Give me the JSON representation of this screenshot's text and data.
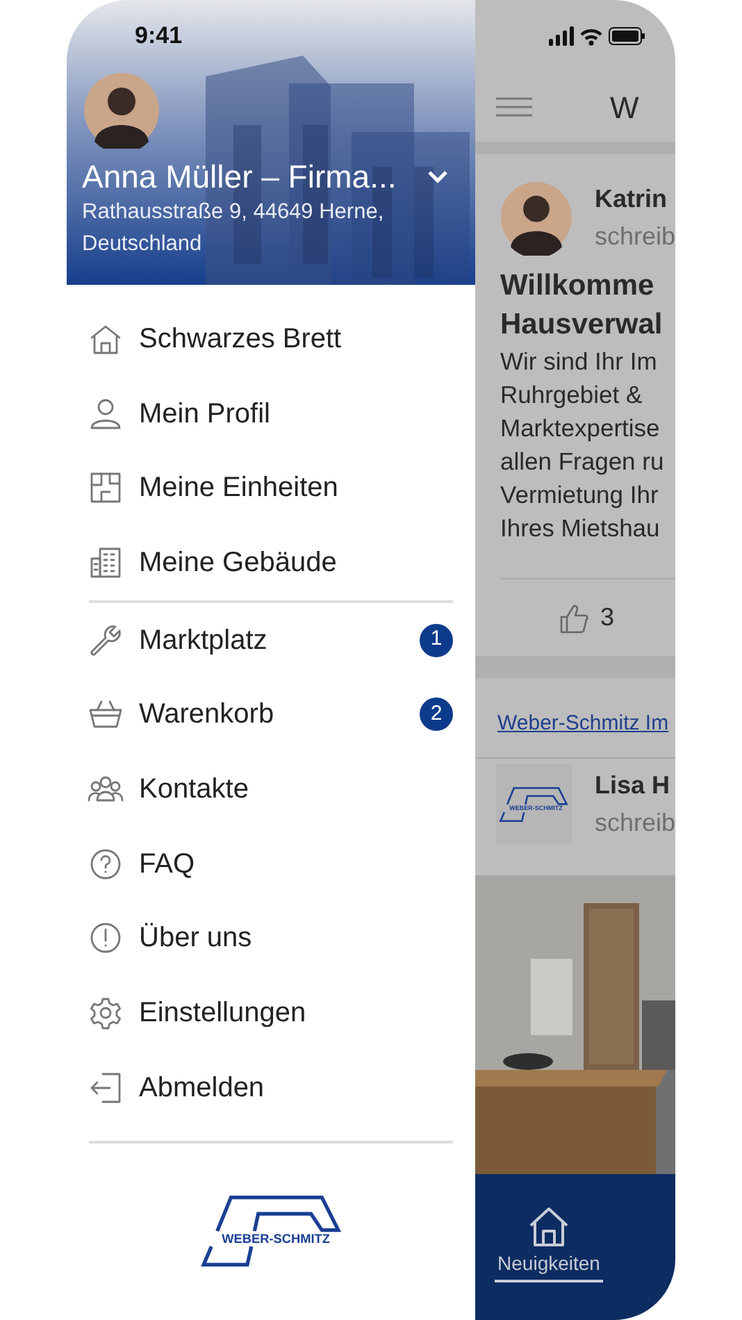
{
  "status_bar": {
    "time": "9:41"
  },
  "drawer": {
    "header": {
      "name": "Anna Müller – Firma...",
      "address": "Rathausstraße 9, 44649 Herne, Deutschland",
      "expanded": false
    },
    "menu_sections": [
      {
        "items": [
          {
            "label": "Schwarzes Brett"
          },
          {
            "label": "Mein Profil"
          },
          {
            "label": "Meine Einheiten"
          },
          {
            "label": "Meine Gebäude"
          }
        ]
      },
      {
        "items": [
          {
            "label": "Marktplatz",
            "badge": "1"
          },
          {
            "label": "Warenkorb",
            "badge": "2"
          },
          {
            "label": "Kontakte"
          },
          {
            "label": "FAQ"
          },
          {
            "label": "Über uns"
          },
          {
            "label": "Einstellungen"
          },
          {
            "label": "Abmelden"
          }
        ]
      }
    ],
    "logo": {
      "text": "WEBER-SCHMITZ"
    }
  },
  "feed": {
    "toolbar_title": "W",
    "posts": [
      {
        "author": "Katrin",
        "action": "schreib",
        "title": [
          "Willkomme",
          "Hausverwal"
        ],
        "body": [
          "Wir sind Ihr Im",
          "Ruhrgebiet &",
          "Marktexpertise",
          "allen Fragen ru",
          "Vermietung Ihr",
          "Ihres Mietshau"
        ],
        "likes": "3"
      }
    ],
    "link": "Weber-Schmitz Im",
    "second_post": {
      "author": "Lisa H",
      "action": "schreib",
      "logo_text": "WEBER-SCHMITZ"
    }
  },
  "bottom_nav": [
    {
      "label": "Neuigkeiten",
      "selected": true
    }
  ]
}
